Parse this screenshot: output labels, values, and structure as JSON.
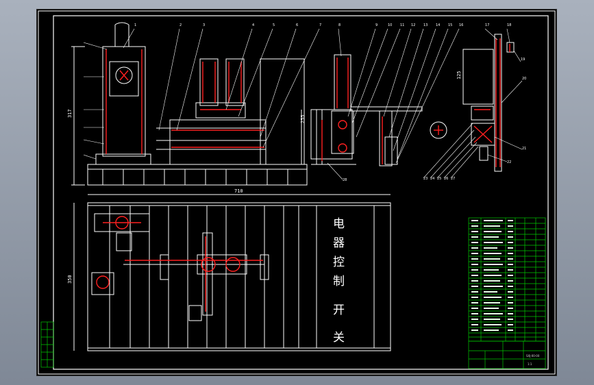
{
  "drawing": {
    "background_color": "#000000",
    "line_color": "#ffffff",
    "hatch_color": "#ff2020",
    "table_color": "#00c800",
    "control_panel_label": "电器控制开关",
    "dimensions": {
      "height_front": "317",
      "height_side": "255",
      "overall_width": "710",
      "plan_depth": "350",
      "cylinder_size": "125"
    },
    "balloons": [
      "1",
      "2",
      "3",
      "4",
      "5",
      "6",
      "7",
      "8",
      "9",
      "10",
      "11",
      "12",
      "13",
      "14",
      "15",
      "16",
      "17",
      "18",
      "19",
      "20",
      "21",
      "22",
      "23",
      "24",
      "25",
      "26",
      "27",
      "28"
    ],
    "title_block": {
      "drawing_number": "SXJ-00-00",
      "scale": "1:1"
    }
  }
}
